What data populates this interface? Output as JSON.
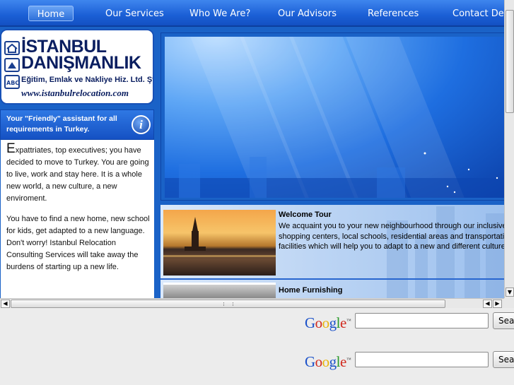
{
  "nav": {
    "items": [
      "Home",
      "Our Services",
      "Who We Are?",
      "Our Advisors",
      "References",
      "Contact Deta"
    ]
  },
  "logo": {
    "line1": "İSTANBUL",
    "line2": "DANIŞMANLIK",
    "line3": "Eğitim, Emlak ve Nakliye Hiz. Ltd. Şti.",
    "website": "www.istanbulrelocation.com"
  },
  "tagline": {
    "text": "Your \"Friendly\" assistant for all requirements in Turkey.",
    "icon": "info-icon",
    "icon_glyph": "i"
  },
  "intro": {
    "p1_first_letter": "E",
    "p1_rest": "xpattriates, top executives; you have decided to move to Turkey. You are going to live, work and stay here. It is a whole new world, a new culture, a new enviroment.",
    "p2": "You have to find a new home, new school for kids, get adapted to a new language. Don't worry! Istanbul Relocation Consulting Services will take away the burdens of starting up a new life."
  },
  "services": [
    {
      "title": "Welcome Tour",
      "text": "We acquaint you to your new neighbourhood through our inclusive shopping centers, local schools, residential areas and transportation facilities which will help you to adapt to a new and different culture."
    },
    {
      "title": "Home Furnishing",
      "text": ""
    }
  ],
  "scrollbars": {
    "up_arrow": "▲",
    "down_arrow": "▼",
    "left_arrow": "◀",
    "right_arrow": "▶"
  },
  "search": {
    "logo_text": "Google",
    "tm": "™",
    "button_label": "Search",
    "input_value": ""
  },
  "colors": {
    "nav_blue": "#1b5fd6",
    "brand_navy": "#0a1e60",
    "banner_blue": "#1e6ee0"
  }
}
